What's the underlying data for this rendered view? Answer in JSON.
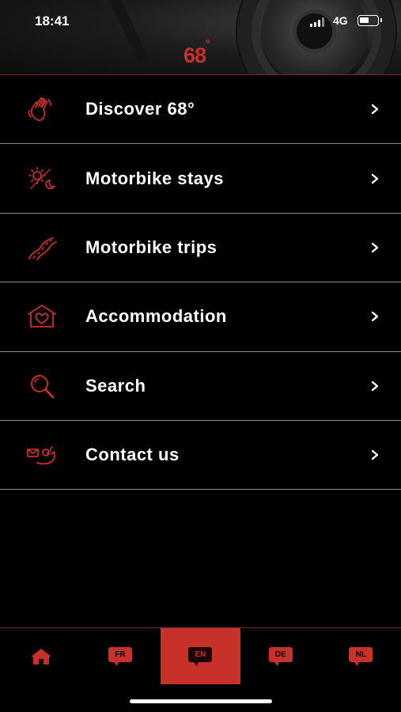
{
  "status_bar": {
    "time": "18:41",
    "network": "4G"
  },
  "header": {
    "logo_text": "68",
    "logo_degree": "°",
    "accent_color": "#c8302a"
  },
  "menu": {
    "items": [
      {
        "label": "Discover 68°",
        "icon": "waving-hand-icon"
      },
      {
        "label": "Motorbike stays",
        "icon": "sun-moon-icon"
      },
      {
        "label": "Motorbike trips",
        "icon": "road-icon"
      },
      {
        "label": "Accommodation",
        "icon": "house-heart-icon"
      },
      {
        "label": "Search",
        "icon": "search-icon"
      },
      {
        "label": "Contact us",
        "icon": "contact-hand-icon"
      }
    ]
  },
  "tabbar": {
    "tabs": [
      {
        "label": "",
        "icon": "home-icon",
        "active": false
      },
      {
        "label": "FR",
        "icon": "speech-bubble-icon",
        "active": false
      },
      {
        "label": "EN",
        "icon": "speech-bubble-icon",
        "active": true
      },
      {
        "label": "DE",
        "icon": "speech-bubble-icon",
        "active": false
      },
      {
        "label": "NL",
        "icon": "speech-bubble-icon",
        "active": false
      }
    ]
  }
}
